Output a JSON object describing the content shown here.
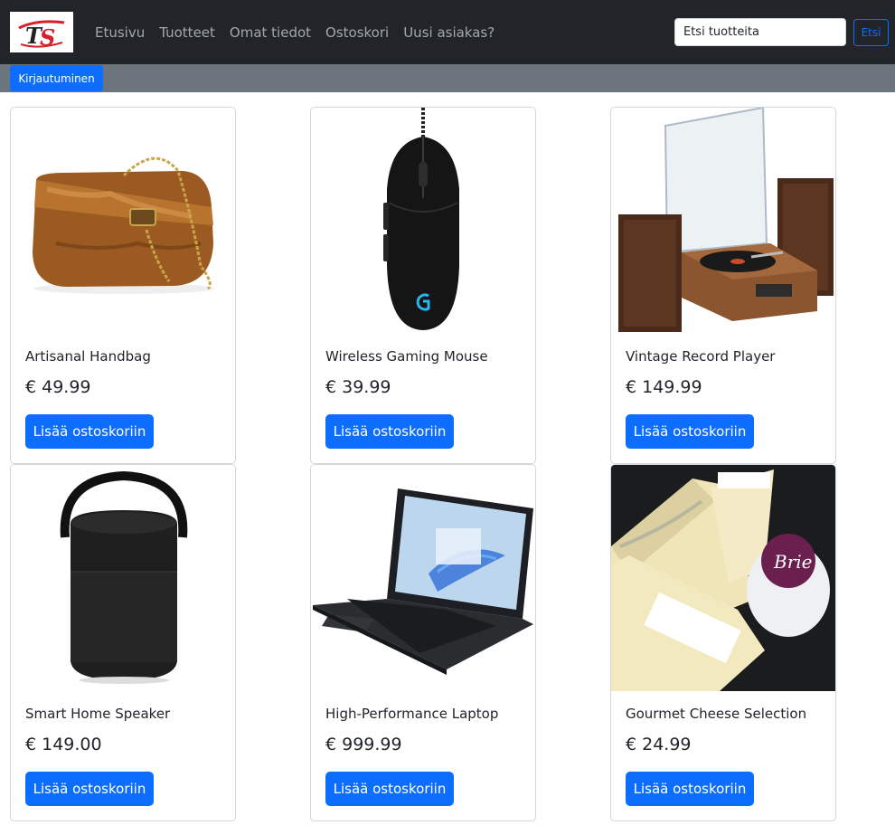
{
  "navbar": {
    "links": [
      "Etusivu",
      "Tuotteet",
      "Omat tiedot",
      "Ostoskori",
      "Uusi asiakas?"
    ],
    "search_placeholder": "Etsi tuotteita",
    "search_button": "Etsi"
  },
  "subbar": {
    "login_label": "Kirjautuminen"
  },
  "products": [
    {
      "name": "Artisanal Handbag",
      "price": "€ 49.99",
      "button": "Lisää ostoskoriin"
    },
    {
      "name": "Wireless Gaming Mouse",
      "price": "€ 39.99",
      "button": "Lisää ostoskoriin"
    },
    {
      "name": "Vintage Record Player",
      "price": "€ 149.99",
      "button": "Lisää ostoskoriin"
    },
    {
      "name": "Smart Home Speaker",
      "price": "€ 149.00",
      "button": "Lisää ostoskoriin"
    },
    {
      "name": "High-Performance Laptop",
      "price": "€ 999.99",
      "button": "Lisää ostoskoriin"
    },
    {
      "name": "Gourmet Cheese Selection",
      "price": "€ 24.99",
      "button": "Lisää ostoskoriin"
    }
  ],
  "theme": {
    "navbar_bg": "#212529",
    "subbar_bg": "#6c757d",
    "primary": "#0d6efd",
    "logo_red": "#d6202a"
  },
  "icons": {
    "logo": "ts-logo-icon"
  }
}
